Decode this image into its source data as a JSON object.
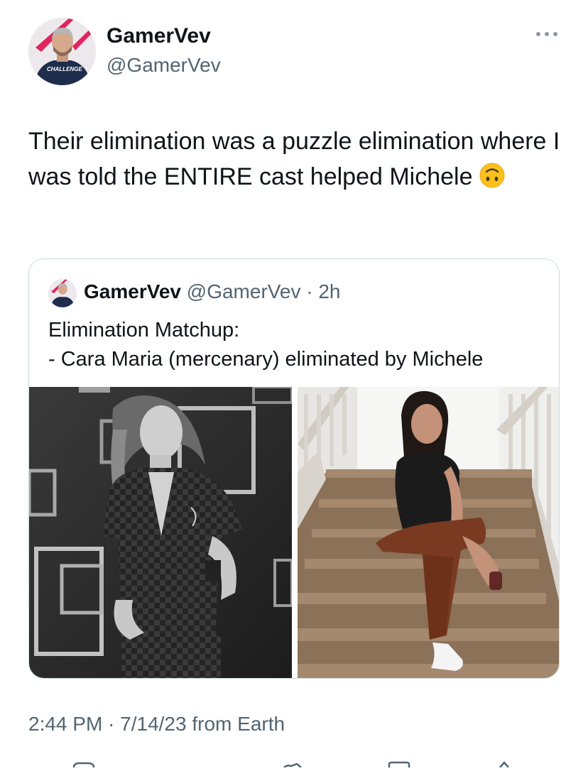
{
  "tweet": {
    "author": {
      "name": "GamerVev",
      "handle": "@GamerVev",
      "avatar_shirt_text": "CHALLENGE"
    },
    "more_icon": "more-horizontal-icon",
    "text": "Their elimination was a puzzle elimination where I was told the ENTIRE cast helped Michele",
    "emoji": "upside-down-face-emoji",
    "timestamp": "2:44 PM · 7/14/23 from Earth"
  },
  "quote": {
    "author_name": "GamerVev",
    "meta": "@GamerVev · 2h",
    "line1": "Elimination Matchup:",
    "line2": "- Cara Maria (mercenary) eliminated by Michele",
    "photos": [
      "black-and-white-portrait-photo",
      "staircase-portrait-photo"
    ]
  },
  "colors": {
    "text": "#0f1419",
    "secondary": "#536471",
    "border": "#cfd9de",
    "accent": "#e0245e"
  }
}
